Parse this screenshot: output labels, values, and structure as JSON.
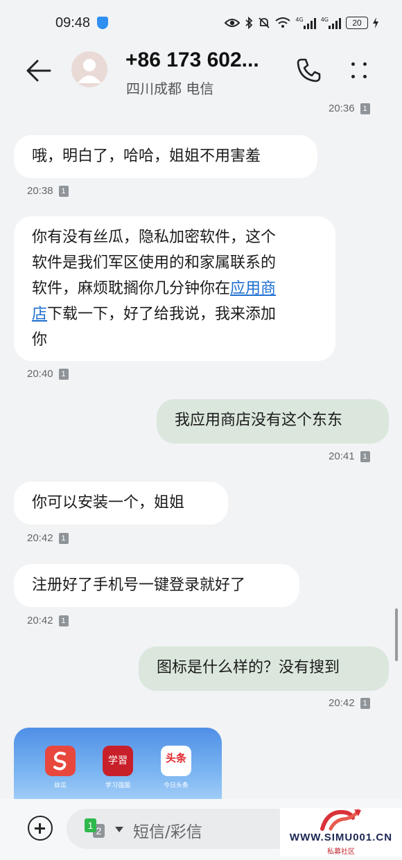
{
  "status_bar": {
    "time": "09:48",
    "network_1": "4G",
    "network_2": "4G",
    "battery": "20"
  },
  "header": {
    "contact_name": "+86 173 602...",
    "contact_location": "四川成都 电信"
  },
  "messages": [
    {
      "direction": "out",
      "time": "20:36",
      "sim": "1",
      "text": ""
    },
    {
      "direction": "in",
      "time": "20:38",
      "sim": "1",
      "text": "哦，明白了，哈哈，姐姐不用害羞"
    },
    {
      "direction": "in",
      "time": "20:40",
      "sim": "1",
      "text_lines": [
        "你有没有丝瓜，隐私加密软件，这个",
        "软件是我们军区使用的和家属联系的",
        "软件，麻烦耽搁你几分钟你在",
        "下载一下，好了给我说，我来添加",
        "你"
      ],
      "link_part1": "应用商",
      "link_part2": "店"
    },
    {
      "direction": "out",
      "time": "20:41",
      "sim": "1",
      "text": "我应用商店没有这个东东"
    },
    {
      "direction": "in",
      "time": "20:42",
      "sim": "1",
      "text": "你可以安装一个，姐姐"
    },
    {
      "direction": "in",
      "time": "20:42",
      "sim": "1",
      "text": "注册好了手机号一键登录就好了"
    },
    {
      "direction": "out",
      "time": "20:42",
      "sim": "1",
      "text": "图标是什么样的？没有搜到"
    }
  ],
  "image_preview": {
    "apps": [
      {
        "label": "丝瓜",
        "icon_text": "S",
        "color": "#e8473d"
      },
      {
        "label": "学习强国",
        "icon_text": "学習",
        "color": "#c8202a"
      },
      {
        "label": "今日头条",
        "icon_text": "头条",
        "color": "#ffffff"
      }
    ]
  },
  "input": {
    "placeholder": "短信/彩信",
    "sim_primary": "1",
    "sim_secondary": "2"
  },
  "watermark": {
    "text": "WWW.SIMU001.CN",
    "sub": "私募社区"
  }
}
